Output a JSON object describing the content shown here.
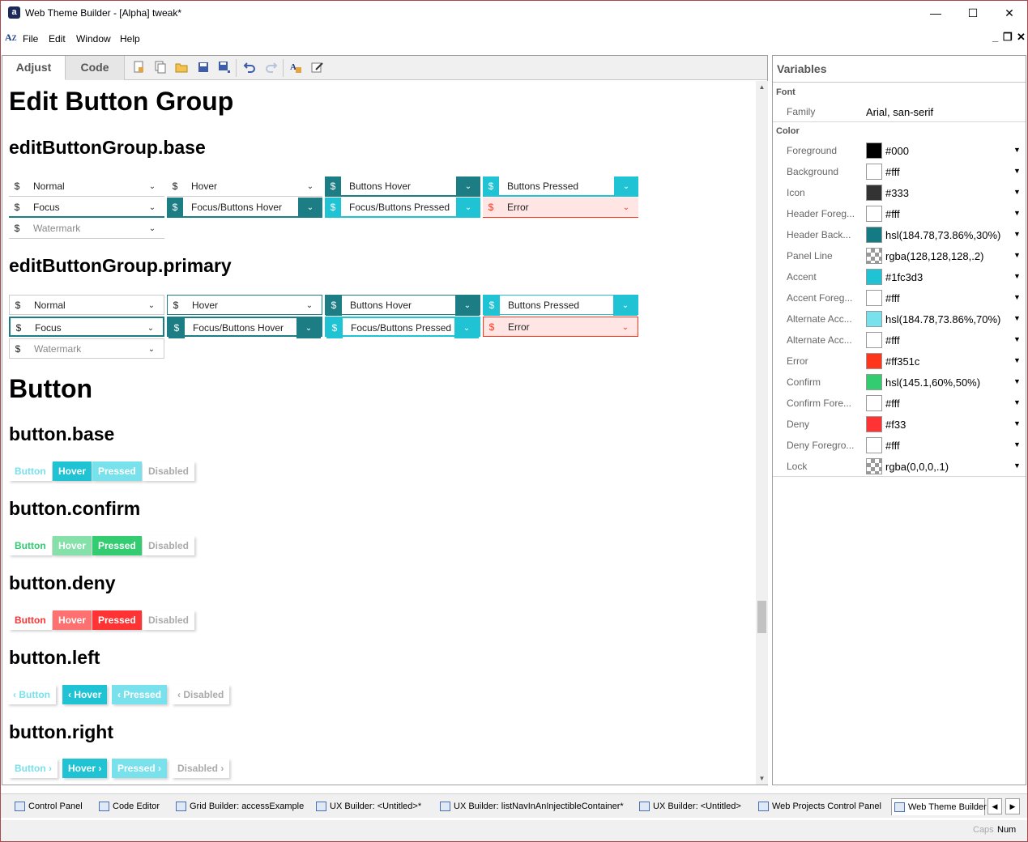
{
  "window": {
    "title": "Web Theme Builder - [Alpha] tweak*",
    "app_icon": "a",
    "minimize": "—",
    "maximize": "☐",
    "close": "✕"
  },
  "menu": {
    "items": [
      "File",
      "Edit",
      "Window",
      "Help"
    ],
    "mdi_minimize": "_",
    "mdi_restore": "❐",
    "mdi_close": "✕"
  },
  "tabs": {
    "adjust": "Adjust",
    "code": "Code"
  },
  "toolbar_icons": [
    "new-document-icon",
    "copy-document-icon",
    "open-folder-icon",
    "save-icon",
    "save-all-icon",
    "undo-icon",
    "redo-icon",
    "font-color-icon",
    "edit-icon"
  ],
  "content": {
    "h_edit_button_group": "Edit Button Group",
    "h_base": "editButtonGroup.base",
    "h_primary": "editButtonGroup.primary",
    "h_button": "Button",
    "h_button_base": "button.base",
    "h_button_confirm": "button.confirm",
    "h_button_deny": "button.deny",
    "h_button_left": "button.left",
    "h_button_right": "button.right",
    "field_prefix": "$",
    "dropdown_glyph": "⌄",
    "fields": {
      "normal": "Normal",
      "hover": "Hover",
      "buttons_hover": "Buttons Hover",
      "buttons_pressed": "Buttons Pressed",
      "focus": "Focus",
      "focus_buttons_hover": "Focus/Buttons Hover",
      "focus_buttons_pressed": "Focus/Buttons Pressed",
      "error": "Error",
      "watermark": "Watermark"
    },
    "buttons": {
      "button": "Button",
      "hover": "Hover",
      "pressed": "Pressed",
      "disabled": "Disabled",
      "chev_left": "‹",
      "chev_right": "›"
    }
  },
  "variables": {
    "title": "Variables",
    "font_group": "Font",
    "font": {
      "name": "Family",
      "value": "Arial, san-serif"
    },
    "color_group": "Color",
    "colors": [
      {
        "name": "Foreground",
        "value": "#000",
        "swatch": "#000000"
      },
      {
        "name": "Background",
        "value": "#fff",
        "swatch": "#ffffff"
      },
      {
        "name": "Icon",
        "value": "#333",
        "swatch": "#333333"
      },
      {
        "name": "Header Foreg...",
        "value": "#fff",
        "swatch": "#ffffff"
      },
      {
        "name": "Header Back...",
        "value": "hsl(184.78,73.86%,30%)",
        "swatch": "#147b85"
      },
      {
        "name": "Panel Line",
        "value": "rgba(128,128,128,.2)",
        "swatch": "checker"
      },
      {
        "name": "Accent",
        "value": "#1fc3d3",
        "swatch": "#1fc3d3"
      },
      {
        "name": "Accent Foreg...",
        "value": "#fff",
        "swatch": "#ffffff"
      },
      {
        "name": "Alternate Acc...",
        "value": "hsl(184.78,73.86%,70%)",
        "swatch": "#79e1eb"
      },
      {
        "name": "Alternate Acc...",
        "value": "#fff",
        "swatch": "#ffffff"
      },
      {
        "name": "Error",
        "value": "#ff351c",
        "swatch": "#ff351c"
      },
      {
        "name": "Confirm",
        "value": "hsl(145.1,60%,50%)",
        "swatch": "#33cc71"
      },
      {
        "name": "Confirm Fore...",
        "value": "#fff",
        "swatch": "#ffffff"
      },
      {
        "name": "Deny",
        "value": "#f33",
        "swatch": "#ff3333"
      },
      {
        "name": "Deny Foregro...",
        "value": "#fff",
        "swatch": "#ffffff"
      },
      {
        "name": "Lock",
        "value": "rgba(0,0,0,.1)",
        "swatch": "checker"
      }
    ],
    "dropdown_arrow": "▼"
  },
  "taskbar": {
    "tabs": [
      "Control Panel",
      "Code Editor",
      "Grid Builder: accessExample",
      "UX Builder: <Untitled>*",
      "UX Builder: listNavInAnInjectibleContainer*",
      "UX Builder: <Untitled>",
      "Web Projects Control Panel",
      "Web Theme Builder"
    ],
    "prev": "◀",
    "next": "▶"
  },
  "status": {
    "caps": "Caps",
    "num": "Num"
  },
  "colors": {
    "accent": "#1fc3d3",
    "header_back": "#1d7d85",
    "alt_accent": "#79e1eb",
    "error": "#ff351c",
    "confirm": "#33cc71",
    "confirm_alt": "#85e0aa",
    "deny": "#ff3333",
    "deny_alt": "#ff7070",
    "disabled": "#aaaaaa"
  }
}
